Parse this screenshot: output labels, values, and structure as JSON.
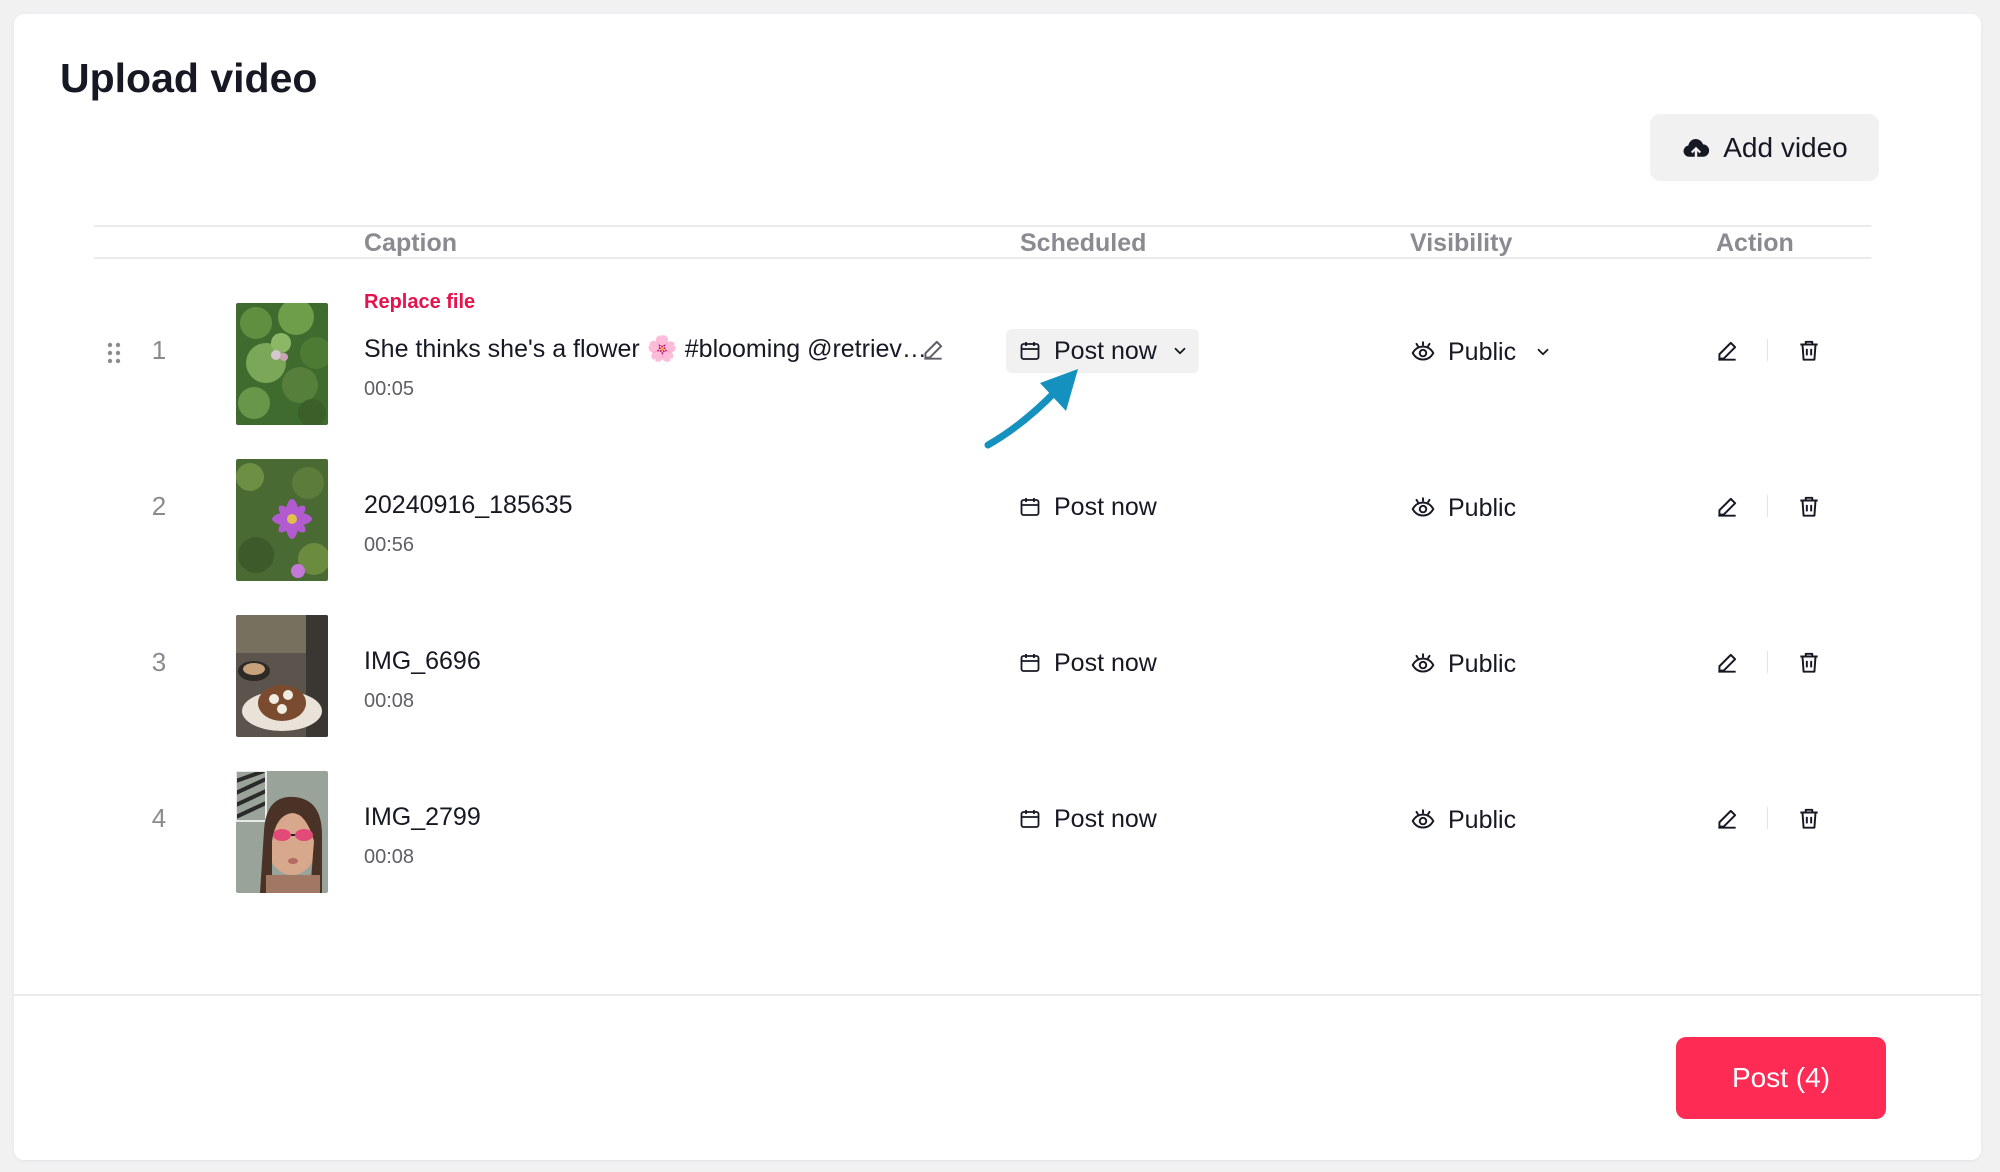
{
  "page": {
    "title": "Upload video"
  },
  "toolbar": {
    "add_video_label": "Add video"
  },
  "table": {
    "headers": {
      "caption": "Caption",
      "scheduled": "Scheduled",
      "visibility": "Visibility",
      "action": "Action"
    },
    "rows": [
      {
        "index": "1",
        "replace_label": "Replace file",
        "caption": "She thinks she's a flower 🌸 #blooming @retriev…",
        "duration": "00:05",
        "schedule": "Post now",
        "visibility": "Public"
      },
      {
        "index": "2",
        "caption": "20240916_185635",
        "duration": "00:56",
        "schedule": "Post now",
        "visibility": "Public"
      },
      {
        "index": "3",
        "caption": "IMG_6696",
        "duration": "00:08",
        "schedule": "Post now",
        "visibility": "Public"
      },
      {
        "index": "4",
        "caption": "IMG_2799",
        "duration": "00:08",
        "schedule": "Post now",
        "visibility": "Public"
      }
    ]
  },
  "footer": {
    "post_label": "Post (4)"
  },
  "colors": {
    "accent": "#fe2c55",
    "replace_text": "#e4134d",
    "annotation_arrow": "#1591bf"
  },
  "icons": [
    "cloud-upload-icon",
    "drag-handle-icon",
    "pencil-icon",
    "calendar-icon",
    "chevron-down-icon",
    "eye-icon",
    "trash-icon",
    "annotation-arrow"
  ]
}
